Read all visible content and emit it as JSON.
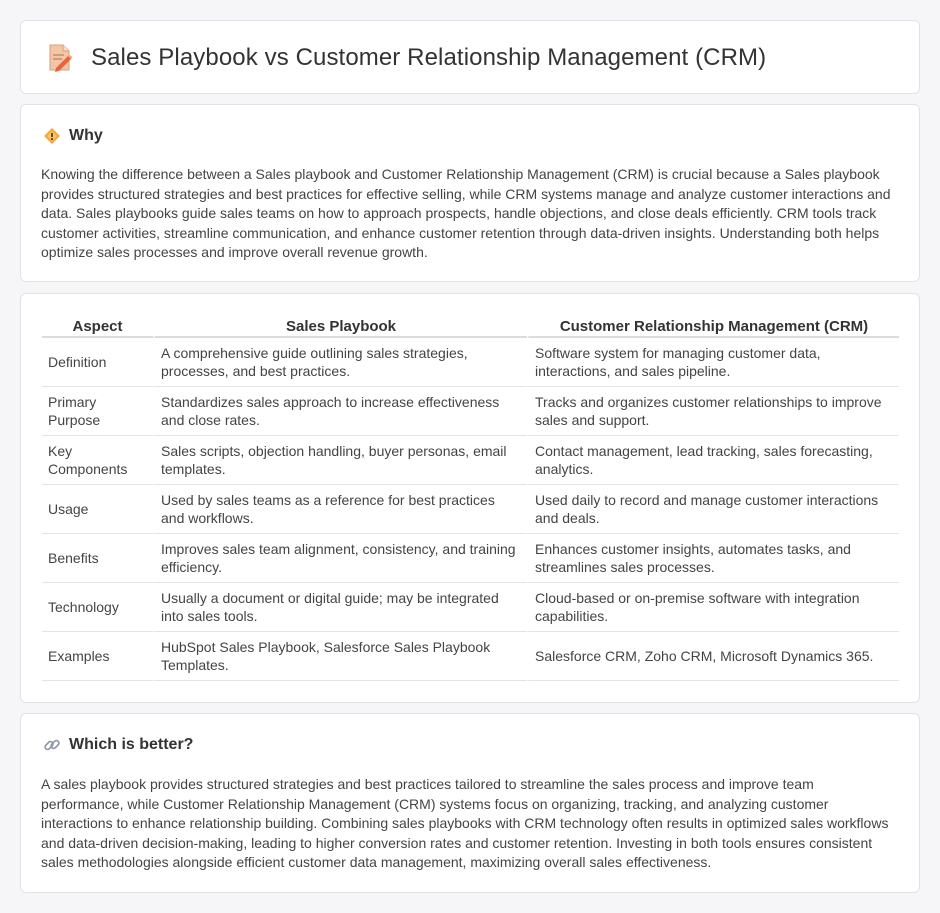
{
  "header": {
    "title": "Sales Playbook vs Customer Relationship Management (CRM)",
    "icon": "document-pencil-icon"
  },
  "why": {
    "title": "Why",
    "icon": "diamond-warning-icon",
    "body": "Knowing the difference between a Sales playbook and Customer Relationship Management (CRM) is crucial because a Sales playbook provides structured strategies and best practices for effective selling, while CRM systems manage and analyze customer interactions and data. Sales playbooks guide sales teams on how to approach prospects, handle objections, and close deals efficiently. CRM tools track customer activities, streamline communication, and enhance customer retention through data-driven insights. Understanding both helps optimize sales processes and improve overall revenue growth."
  },
  "table": {
    "headers": [
      "Aspect",
      "Sales Playbook",
      "Customer Relationship Management (CRM)"
    ],
    "rows": [
      [
        "Definition",
        "A comprehensive guide outlining sales strategies, processes, and best practices.",
        "Software system for managing customer data, interactions, and sales pipeline."
      ],
      [
        "Primary Purpose",
        "Standardizes sales approach to increase effectiveness and close rates.",
        "Tracks and organizes customer relationships to improve sales and support."
      ],
      [
        "Key Components",
        "Sales scripts, objection handling, buyer personas, email templates.",
        "Contact management, lead tracking, sales forecasting, analytics."
      ],
      [
        "Usage",
        "Used by sales teams as a reference for best practices and workflows.",
        "Used daily to record and manage customer interactions and deals."
      ],
      [
        "Benefits",
        "Improves sales team alignment, consistency, and training efficiency.",
        "Enhances customer insights, automates tasks, and streamlines sales processes."
      ],
      [
        "Technology",
        "Usually a document or digital guide; may be integrated into sales tools.",
        "Cloud-based or on-premise software with integration capabilities."
      ],
      [
        "Examples",
        "HubSpot Sales Playbook, Salesforce Sales Playbook Templates.",
        "Salesforce CRM, Zoho CRM, Microsoft Dynamics 365."
      ]
    ]
  },
  "better": {
    "title": "Which is better?",
    "icon": "link-icon",
    "body": "A sales playbook provides structured strategies and best practices tailored to streamline the sales process and improve team performance, while Customer Relationship Management (CRM) systems focus on organizing, tracking, and analyzing customer interactions to enhance relationship building. Combining sales playbooks with CRM technology often results in optimized sales workflows and data-driven decision-making, leading to higher conversion rates and customer retention. Investing in both tools ensures consistent sales methodologies alongside efficient customer data management, maximizing overall sales effectiveness."
  }
}
